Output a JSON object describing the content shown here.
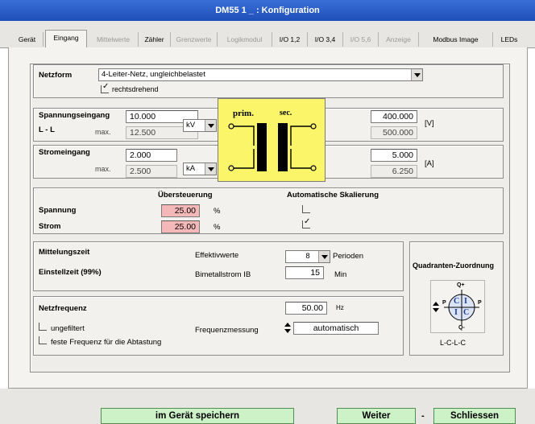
{
  "window": {
    "title": "DM55 1 _ : Konfiguration"
  },
  "tabs": [
    {
      "label": "Gerät",
      "state": "normal"
    },
    {
      "label": "Eingang",
      "state": "active"
    },
    {
      "label": "Mittelwerte",
      "state": "disabled"
    },
    {
      "label": "Zähler",
      "state": "normal"
    },
    {
      "label": "Grenzwerte",
      "state": "disabled"
    },
    {
      "label": "Logikmodul",
      "state": "disabled"
    },
    {
      "label": "I/O 1,2",
      "state": "normal"
    },
    {
      "label": "I/O 3,4",
      "state": "normal"
    },
    {
      "label": "I/O 5,6",
      "state": "disabled"
    },
    {
      "label": "Anzeige",
      "state": "disabled"
    },
    {
      "label": "Modbus Image",
      "state": "normal"
    },
    {
      "label": "LEDs",
      "state": "normal"
    }
  ],
  "netzform": {
    "label": "Netzform",
    "value": "4-Leiter-Netz, ungleichbelastet",
    "rechtsdrehend_label": "rechtsdrehend",
    "rechtsdrehend_checked": true
  },
  "spannungseingang": {
    "label": "Spannungseingang",
    "sublabel": "L - L",
    "max_label": "max.",
    "primary_value": "10.000",
    "primary_max": "12.500",
    "unit_select": "kV",
    "secondary_value": "400.000",
    "secondary_max": "500.000",
    "secondary_unit": "[V]"
  },
  "stromeingang": {
    "label": "Stromeingang",
    "max_label": "max.",
    "primary_value": "2.000",
    "primary_max": "2.500",
    "unit_select": "kA",
    "secondary_value": "5.000",
    "secondary_max": "6.250",
    "secondary_unit": "[A]"
  },
  "transformer": {
    "prim_label": "prim.",
    "sec_label": "sec."
  },
  "uebersteuerung": {
    "header": "Übersteuerung",
    "auto_header": "Automatische Skalierung",
    "spannung_label": "Spannung",
    "spannung_value": "25.00",
    "spannung_unit": "%",
    "spannung_auto": false,
    "strom_label": "Strom",
    "strom_value": "25.00",
    "strom_unit": "%",
    "strom_auto": true
  },
  "mittelung": {
    "label": "Mittelungszeit",
    "einstell_label": "Einstellzeit (99%)",
    "effektiv_label": "Effektivwerte",
    "effektiv_value": "8",
    "perioden_label": "Perioden",
    "bimetall_label": "Bimetallstrom IB",
    "bimetall_value": "15",
    "bimetall_unit": "Min"
  },
  "netzfrequenz": {
    "label": "Netzfrequenz",
    "value": "50.00",
    "unit": "Hz",
    "ungefiltert_label": "ungefiltert",
    "ungefiltert_checked": false,
    "feste_label": "feste Frequenz für die Abtastung",
    "feste_checked": false,
    "messung_label": "Frequenzmessung",
    "messung_value": "automatisch"
  },
  "quadranten": {
    "label": "Quadranten-Zuordnung",
    "q_top": "Q+",
    "q_bottom": "Q-",
    "p_left": "P",
    "p_right": "P",
    "quad_tl": "C",
    "quad_tr": "I",
    "quad_bl": "I",
    "quad_br": "C",
    "code": "L-C-L-C"
  },
  "buttons": {
    "save": "im Gerät speichern",
    "next": "Weiter",
    "separator": "-",
    "close": "Schliessen"
  }
}
